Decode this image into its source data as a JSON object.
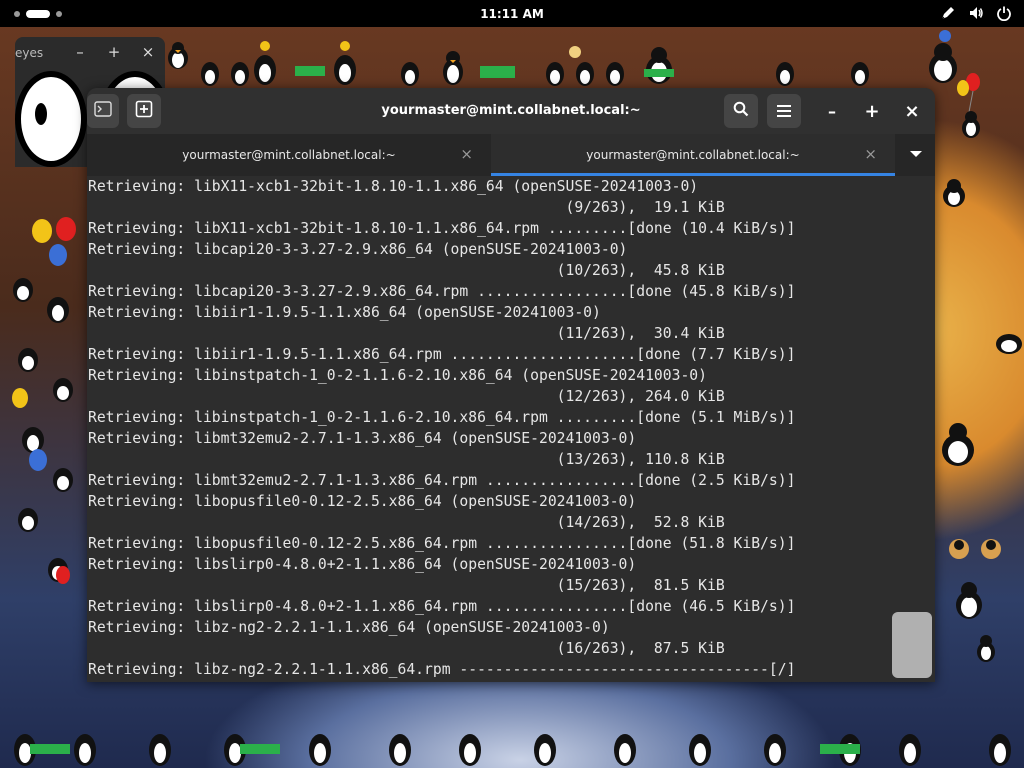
{
  "topbar": {
    "clock": "11:11 AM",
    "icons": [
      "pen-icon",
      "volume-icon",
      "power-icon"
    ]
  },
  "eyes_window": {
    "title": "eyes",
    "buttons": [
      "–",
      "+",
      "×"
    ]
  },
  "terminal": {
    "title": "yourmaster@mint.collabnet.local:~",
    "tabs": [
      {
        "label": "yourmaster@mint.collabnet.local:~",
        "active": false
      },
      {
        "label": "yourmaster@mint.collabnet.local:~",
        "active": true
      }
    ],
    "tab_close": "×",
    "window_buttons": {
      "minimize": "–",
      "maximize": "+",
      "close": "×"
    },
    "lines": [
      "Retrieving: libX11-xcb1-32bit-1.8.10-1.1.x86_64 (openSUSE-20241003-0)",
      "                                                      (9/263),  19.1 KiB",
      "Retrieving: libX11-xcb1-32bit-1.8.10-1.1.x86_64.rpm .........[done (10.4 KiB/s)]",
      "Retrieving: libcapi20-3-3.27-2.9.x86_64 (openSUSE-20241003-0)",
      "                                                     (10/263),  45.8 KiB",
      "Retrieving: libcapi20-3-3.27-2.9.x86_64.rpm .................[done (45.8 KiB/s)]",
      "Retrieving: libiir1-1.9.5-1.1.x86_64 (openSUSE-20241003-0)",
      "                                                     (11/263),  30.4 KiB",
      "Retrieving: libiir1-1.9.5-1.1.x86_64.rpm .....................[done (7.7 KiB/s)]",
      "Retrieving: libinstpatch-1_0-2-1.1.6-2.10.x86_64 (openSUSE-20241003-0)",
      "                                                     (12/263), 264.0 KiB",
      "Retrieving: libinstpatch-1_0-2-1.1.6-2.10.x86_64.rpm .........[done (5.1 MiB/s)]",
      "Retrieving: libmt32emu2-2.7.1-1.3.x86_64 (openSUSE-20241003-0)",
      "                                                     (13/263), 110.8 KiB",
      "Retrieving: libmt32emu2-2.7.1-1.3.x86_64.rpm .................[done (2.5 KiB/s)]",
      "Retrieving: libopusfile0-0.12-2.5.x86_64 (openSUSE-20241003-0)",
      "                                                     (14/263),  52.8 KiB",
      "Retrieving: libopusfile0-0.12-2.5.x86_64.rpm ................[done (51.8 KiB/s)]",
      "Retrieving: libslirp0-4.8.0+2-1.1.x86_64 (openSUSE-20241003-0)",
      "                                                     (15/263),  81.5 KiB",
      "Retrieving: libslirp0-4.8.0+2-1.1.x86_64.rpm ................[done (46.5 KiB/s)]",
      "Retrieving: libz-ng2-2.2.1-1.1.x86_64 (openSUSE-20241003-0)",
      "                                                     (16/263),  87.5 KiB",
      "Retrieving: libz-ng2-2.2.1-1.1.x86_64.rpm -----------------------------------[/]"
    ]
  },
  "colors": {
    "accent": "#3584e4",
    "terminal_bg": "#2d2d2d",
    "headerbar_bg": "#303030"
  }
}
